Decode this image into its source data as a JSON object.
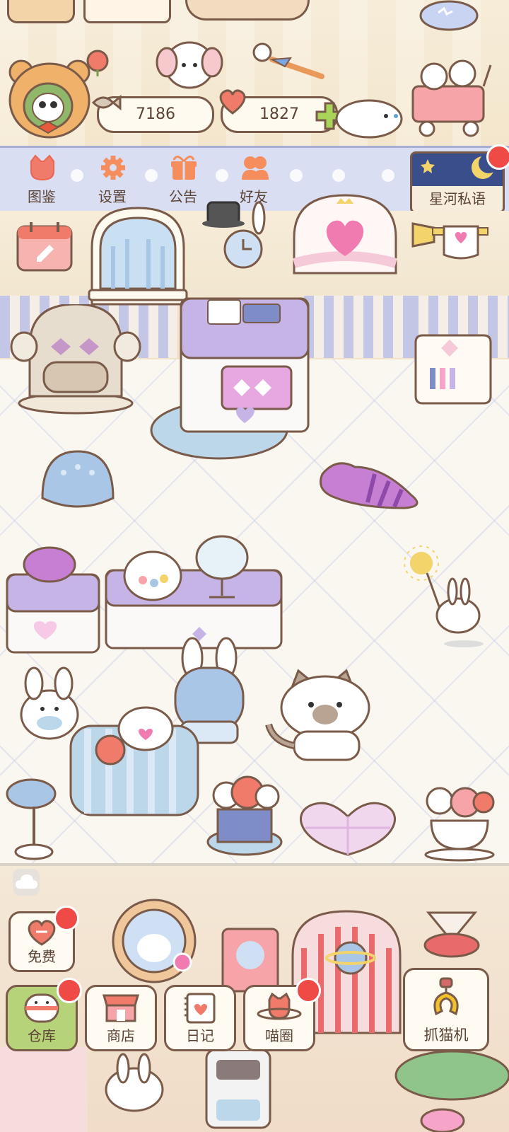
{
  "currency": {
    "fish_count": "7186",
    "heart_count": "1827"
  },
  "menu": {
    "items": [
      {
        "label": "图鉴",
        "icon": "cat-head-icon"
      },
      {
        "label": "设置",
        "icon": "gear-icon"
      },
      {
        "label": "公告",
        "icon": "gift-icon"
      },
      {
        "label": "好友",
        "icon": "friends-icon"
      }
    ],
    "starriver_label": "星河私语"
  },
  "bottom": {
    "free_label": "免费",
    "warehouse_label": "仓库",
    "shop_label": "商店",
    "diary_label": "日记",
    "circle_label": "喵圈",
    "claw_label": "抓猫机"
  },
  "colors": {
    "accent_red": "#ef4a46",
    "band": "#d9def2",
    "warehouse_green": "#b7d37a",
    "outline": "#7a5a48"
  }
}
